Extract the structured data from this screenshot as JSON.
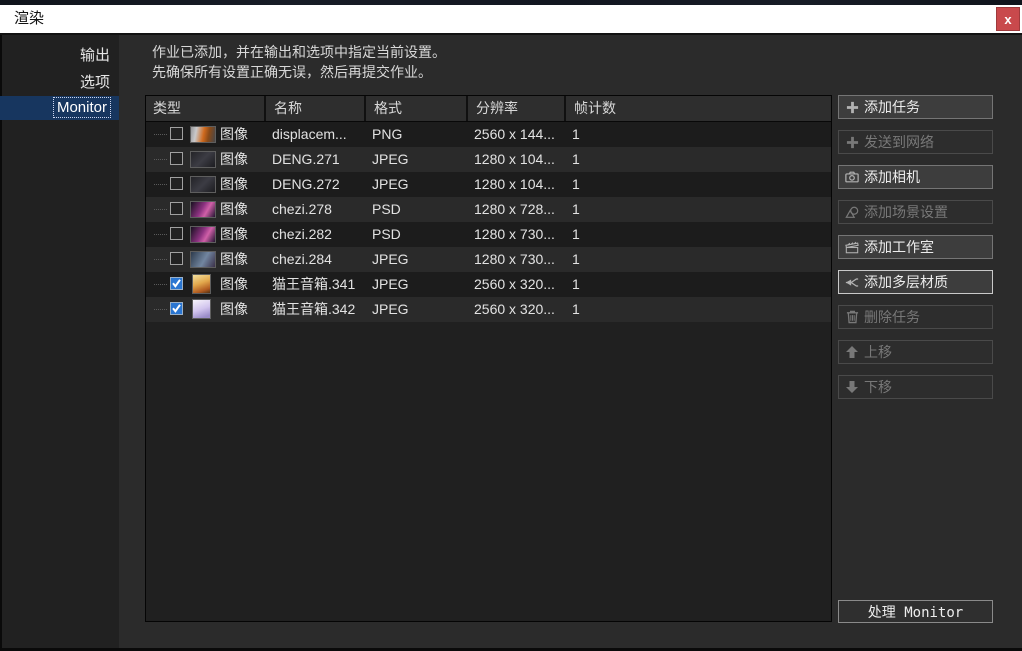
{
  "window": {
    "title": "渲染",
    "close_label": "x"
  },
  "sidebar": {
    "items": [
      {
        "label": "输出",
        "selected": false
      },
      {
        "label": "选项",
        "selected": false
      },
      {
        "label": "Monitor",
        "selected": true
      }
    ]
  },
  "message": {
    "line1": "作业已添加，并在输出和选项中指定当前设置。",
    "line2": "先确保所有设置正确无误，然后再提交作业。"
  },
  "table": {
    "columns": [
      "类型",
      "名称",
      "格式",
      "分辨率",
      "帧计数"
    ],
    "rows": [
      {
        "checked": false,
        "type_label": "图像",
        "name": "displacem...",
        "format": "PNG",
        "resolution": "2560 x 144...",
        "frames": "1",
        "thumb": "thumb-car-orange",
        "thumb_shape": "wide"
      },
      {
        "checked": false,
        "type_label": "图像",
        "name": "DENG.271",
        "format": "JPEG",
        "resolution": "1280 x 104...",
        "frames": "1",
        "thumb": "thumb-dark-lamp",
        "thumb_shape": "wide"
      },
      {
        "checked": false,
        "type_label": "图像",
        "name": "DENG.272",
        "format": "JPEG",
        "resolution": "1280 x 104...",
        "frames": "1",
        "thumb": "thumb-dark-lamp",
        "thumb_shape": "wide"
      },
      {
        "checked": false,
        "type_label": "图像",
        "name": "chezi.278",
        "format": "PSD",
        "resolution": "1280 x 728...",
        "frames": "1",
        "thumb": "thumb-car-magenta",
        "thumb_shape": "wide"
      },
      {
        "checked": false,
        "type_label": "图像",
        "name": "chezi.282",
        "format": "PSD",
        "resolution": "1280 x 730...",
        "frames": "1",
        "thumb": "thumb-car-magenta",
        "thumb_shape": "wide"
      },
      {
        "checked": false,
        "type_label": "图像",
        "name": "chezi.284",
        "format": "JPEG",
        "resolution": "1280 x 730...",
        "frames": "1",
        "thumb": "thumb-car-blue",
        "thumb_shape": "wide"
      },
      {
        "checked": true,
        "type_label": "图像",
        "name": "猫王音箱.341",
        "format": "JPEG",
        "resolution": "2560 x 320...",
        "frames": "1",
        "thumb": "thumb-speaker-warm",
        "thumb_shape": "tall"
      },
      {
        "checked": true,
        "type_label": "图像",
        "name": "猫王音箱.342",
        "format": "JPEG",
        "resolution": "2560 x 320...",
        "frames": "1",
        "thumb": "thumb-speaker-lavender",
        "thumb_shape": "tall"
      }
    ]
  },
  "actions": [
    {
      "slug": "add-task",
      "label": "添加任务",
      "icon": "plus-icon",
      "enabled": true,
      "focused": false
    },
    {
      "slug": "send-to-network",
      "label": "发送到网络",
      "icon": "plus-icon",
      "enabled": false,
      "focused": false
    },
    {
      "slug": "add-camera",
      "label": "添加相机",
      "icon": "camera-icon",
      "enabled": true,
      "focused": false
    },
    {
      "slug": "add-scene-settings",
      "label": "添加场景设置",
      "icon": "shapes-icon",
      "enabled": false,
      "focused": false
    },
    {
      "slug": "add-studio",
      "label": "添加工作室",
      "icon": "clapperboard-icon",
      "enabled": true,
      "focused": false
    },
    {
      "slug": "add-multilayer-material",
      "label": "添加多层材质",
      "icon": "branch-icon",
      "enabled": true,
      "focused": true
    },
    {
      "slug": "delete-task",
      "label": "删除任务",
      "icon": "trash-icon",
      "enabled": false,
      "focused": false
    },
    {
      "slug": "move-up",
      "label": "上移",
      "icon": "arrow-up-icon",
      "enabled": false,
      "focused": false
    },
    {
      "slug": "move-down",
      "label": "下移",
      "icon": "arrow-down-icon",
      "enabled": false,
      "focused": false
    }
  ],
  "process_button": {
    "label": "处理 Monitor"
  },
  "colors": {
    "selection_blue": "#17365f",
    "checkbox_blue": "#2a76d2",
    "close_red": "#c9494c",
    "titlebar_bg": "#ffffff",
    "dialog_bg": "#2b2b2b",
    "row_odd": "#1c1c1c",
    "row_even": "#2a2a2a"
  }
}
